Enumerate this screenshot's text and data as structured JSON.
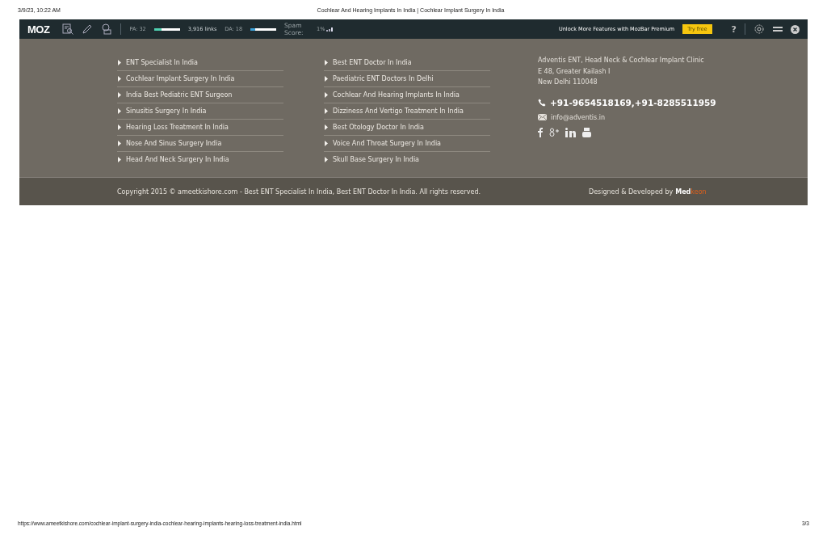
{
  "print_header": {
    "date": "3/9/23, 10:22 AM",
    "title": "Cochlear And Hearing Implants In India | Cochlear Implant Surgery In India"
  },
  "mozbar": {
    "logo": "MOZ",
    "pa": "PA: 32",
    "pa_meter": {
      "level": 0.3
    },
    "links": "3,916 links",
    "da": "DA: 18",
    "da_meter": {
      "level": 0.2
    },
    "spam_label": "Spam Score:",
    "spam_value": "1%",
    "promo": "Unlock More Features with MozBar Premium",
    "try_button": "Try free",
    "help": "?"
  },
  "quick_links": [
    [
      "ENT Specialist In India",
      "Cochlear Implant Surgery In India",
      "India Best Pediatric ENT Surgeon",
      "Sinusitis Surgery In India",
      "Hearing Loss Treatment In India",
      "Nose And Sinus Surgery India",
      "Head And Neck Surgery In India"
    ],
    [
      "Best ENT Doctor In India",
      "Paediatric ENT Doctors In Delhi",
      "Cochlear And Hearing Implants In India",
      "Dizziness And Vertigo Treatment In India",
      "Best Otology Doctor In India",
      "Voice And Throat Surgery In India",
      "Skull Base Surgery In India"
    ]
  ],
  "contact": {
    "address": [
      "Adventis ENT, Head Neck & Cochlear Implant Clinic",
      "E 48, Greater Kailash I",
      "New Delhi 110048"
    ],
    "phone": "+91-9654518169,+91-8285511959",
    "email": "info@adventis.in"
  },
  "footer": {
    "copyright": "Copyright 2015 © ameetkishore.com - Best ENT Specialist In India, Best ENT Doctor In India. All rights reserved.",
    "credit": "Designed & Developed by",
    "brand_first": "Med",
    "brand_second": "keon"
  },
  "print_footer": {
    "url": "https://www.ameetkishore.com/cochlear-implant-surgery-india-cochlear-hearing-implants-hearing-loss-treatment-india.html",
    "page": "3/3"
  }
}
